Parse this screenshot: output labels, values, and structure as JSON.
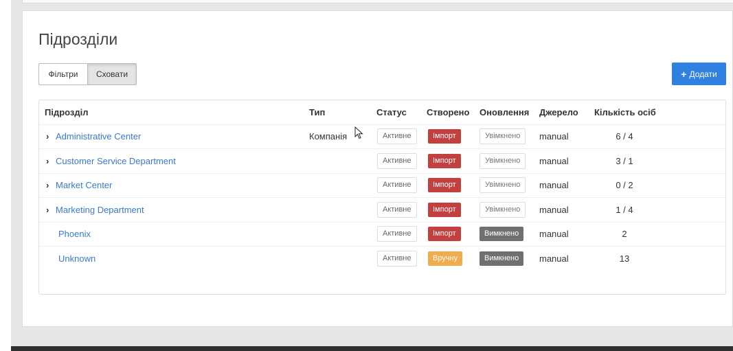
{
  "page": {
    "title": "Підрозділи",
    "filters_label": "Фільтри",
    "hide_label": "Сховати",
    "add_label": "Додати"
  },
  "table": {
    "columns": [
      "Підрозділ",
      "Тип",
      "Статус",
      "Створено",
      "Оновлення",
      "Джерело",
      "Кількість осіб"
    ],
    "rows": [
      {
        "name": "Administrative Center",
        "type": "Компанія",
        "status": "Активне",
        "created": "Імпорт",
        "updated": "Увімкнено",
        "source": "manual",
        "count": "6 / 4",
        "expandable": true
      },
      {
        "name": "Customer Service Department",
        "type": "",
        "status": "Активне",
        "created": "Імпорт",
        "updated": "Увімкнено",
        "source": "manual",
        "count": "3 / 1",
        "expandable": true
      },
      {
        "name": "Market Center",
        "type": "",
        "status": "Активне",
        "created": "Імпорт",
        "updated": "Увімкнено",
        "source": "manual",
        "count": "0 / 2",
        "expandable": true
      },
      {
        "name": "Marketing Department",
        "type": "",
        "status": "Активне",
        "created": "Імпорт",
        "updated": "Увімкнено",
        "source": "manual",
        "count": "1 / 4",
        "expandable": true
      },
      {
        "name": "Phoenix",
        "type": "",
        "status": "Активне",
        "created": "Імпорт",
        "updated": "Вимкнено",
        "source": "manual",
        "count": "2",
        "expandable": false
      },
      {
        "name": "Unknown",
        "type": "",
        "status": "Активне",
        "created": "Вручну",
        "updated": "Вимкнено",
        "source": "manual",
        "count": "13",
        "expandable": false
      }
    ]
  },
  "colors": {
    "accent": "#2f80e0",
    "import": "#c34040",
    "manual": "#f0ad4e",
    "disabled": "#707070",
    "link": "#3a78c9"
  }
}
